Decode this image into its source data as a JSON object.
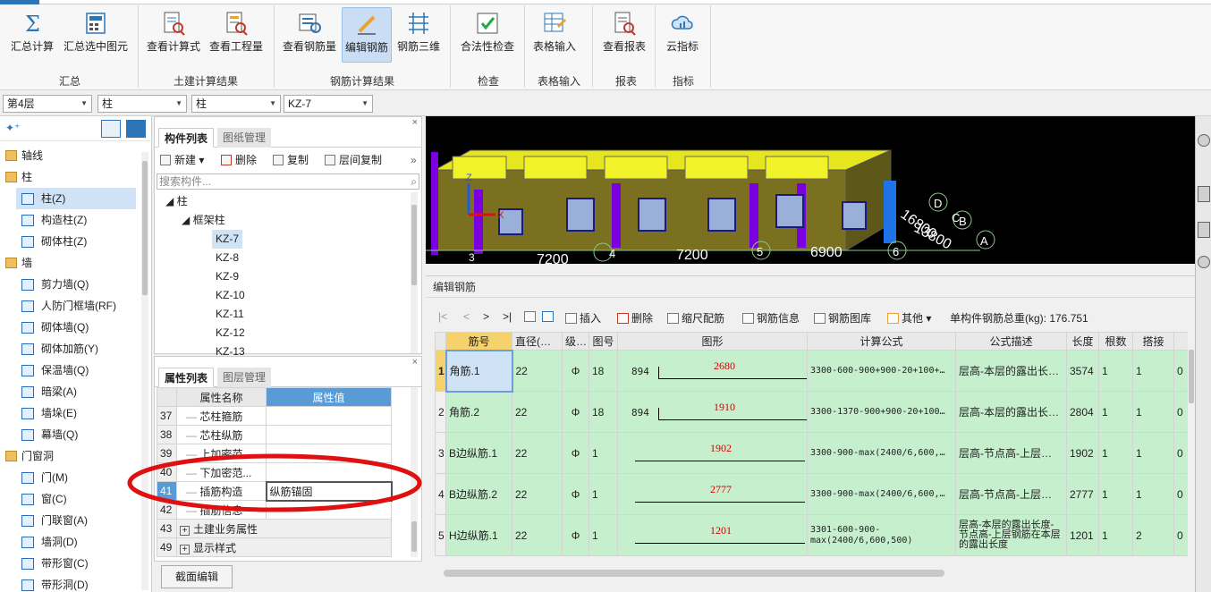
{
  "ribbon": {
    "buttons": [
      {
        "label": "汇总计算",
        "icon": "sigma-icon"
      },
      {
        "label": "汇总选中图元",
        "icon": "calculator-icon"
      },
      {
        "label": "查看计算式",
        "icon": "view-formula-icon"
      },
      {
        "label": "查看工程量",
        "icon": "view-quantity-icon"
      },
      {
        "label": "查看钢筋量",
        "icon": "view-rebar-icon"
      },
      {
        "label": "编辑钢筋",
        "icon": "edit-rebar-icon"
      },
      {
        "label": "钢筋三维",
        "icon": "rebar-3d-icon"
      },
      {
        "label": "合法性检查",
        "icon": "check-icon"
      },
      {
        "label": "表格输入",
        "icon": "table-input-icon"
      },
      {
        "label": "查看报表",
        "icon": "report-icon"
      },
      {
        "label": "云指标",
        "icon": "cloud-icon"
      }
    ],
    "groups": [
      "汇总",
      "土建计算结果",
      "钢筋计算结果",
      "检查",
      "表格输入",
      "报表",
      "指标"
    ]
  },
  "dropdowns": [
    "第4层",
    "柱",
    "柱",
    "KZ-7"
  ],
  "leftnav": {
    "items": [
      {
        "label": "轴线",
        "type": "group"
      },
      {
        "label": "柱",
        "type": "group"
      },
      {
        "label": "柱(Z)",
        "type": "item",
        "selected": true
      },
      {
        "label": "构造柱(Z)",
        "type": "item"
      },
      {
        "label": "砌体柱(Z)",
        "type": "item"
      },
      {
        "label": "墙",
        "type": "group"
      },
      {
        "label": "剪力墙(Q)",
        "type": "item"
      },
      {
        "label": "人防门框墙(RF)",
        "type": "item"
      },
      {
        "label": "砌体墙(Q)",
        "type": "item"
      },
      {
        "label": "砌体加筋(Y)",
        "type": "item"
      },
      {
        "label": "保温墙(Q)",
        "type": "item"
      },
      {
        "label": "暗梁(A)",
        "type": "item"
      },
      {
        "label": "墙垛(E)",
        "type": "item"
      },
      {
        "label": "幕墙(Q)",
        "type": "item"
      },
      {
        "label": "门窗洞",
        "type": "group"
      },
      {
        "label": "门(M)",
        "type": "item"
      },
      {
        "label": "窗(C)",
        "type": "item"
      },
      {
        "label": "门联窗(A)",
        "type": "item"
      },
      {
        "label": "墙洞(D)",
        "type": "item"
      },
      {
        "label": "带形窗(C)",
        "type": "item"
      },
      {
        "label": "带形洞(D)",
        "type": "item"
      }
    ]
  },
  "complist": {
    "tabs": [
      "构件列表",
      "图纸管理"
    ],
    "toolbar": [
      "新建",
      "删除",
      "复制",
      "层间复制"
    ],
    "search_placeholder": "搜索构件...",
    "tree_root": "柱",
    "tree_group": "框架柱",
    "tree_items": [
      "KZ-7",
      "KZ-8",
      "KZ-9",
      "KZ-10",
      "KZ-11",
      "KZ-12",
      "KZ-13"
    ]
  },
  "proppanel": {
    "tabs": [
      "属性列表",
      "图层管理"
    ],
    "col_name": "属性名称",
    "col_value": "属性值",
    "rows": [
      {
        "num": "37",
        "name": "芯柱箍筋",
        "value": ""
      },
      {
        "num": "38",
        "name": "芯柱纵筋",
        "value": ""
      },
      {
        "num": "39",
        "name": "上加密范...",
        "value": ""
      },
      {
        "num": "40",
        "name": "下加密范...",
        "value": ""
      },
      {
        "num": "41",
        "name": "插筋构造",
        "value": "纵筋锚固"
      },
      {
        "num": "42",
        "name": "插筋信息",
        "value": ""
      },
      {
        "num": "43",
        "name": "土建业务属性",
        "value": ""
      },
      {
        "num": "49",
        "name": "显示样式",
        "value": ""
      }
    ],
    "expand_symbol": "+"
  },
  "section_edit_label": "截面编辑",
  "view3d": {
    "axis_numbers": [
      "7200",
      "7200",
      "6900",
      "4",
      "5",
      "6",
      "A",
      "B",
      "C",
      "D",
      "13800",
      "16800",
      "3",
      "X",
      "Z"
    ]
  },
  "editor": {
    "title": "编辑钢筋",
    "nav": [
      "|<",
      "<",
      ">",
      ">|"
    ],
    "toolbar": [
      "插入",
      "删除",
      "缩尺配筋",
      "钢筋信息",
      "钢筋图库",
      "其他"
    ],
    "total_weight_label": "单构件钢筋总重(kg): 176.751",
    "columns": [
      "筋号",
      "直径(mm)",
      "级别",
      "图号",
      "图形",
      "计算公式",
      "公式描述",
      "长度",
      "根数",
      "搭接",
      ""
    ],
    "rows": [
      {
        "num": "1",
        "name": "角筋.1",
        "dia": "22",
        "grade": "Φ",
        "fig": "18",
        "shape_left": "894",
        "shape_val": "2680",
        "formula": "3300-600-900+900-20+100+…",
        "desc": "层高-本层的露出长…",
        "len": "3574",
        "count": "1",
        "lap": "1",
        "extra": "0"
      },
      {
        "num": "2",
        "name": "角筋.2",
        "dia": "22",
        "grade": "Φ",
        "fig": "18",
        "shape_left": "894",
        "shape_val": "1910",
        "formula": "3300-1370-900+900-20+100…",
        "desc": "层高-本层的露出长…",
        "len": "2804",
        "count": "1",
        "lap": "1",
        "extra": "0"
      },
      {
        "num": "3",
        "name": "B边纵筋.1",
        "dia": "22",
        "grade": "Φ",
        "fig": "1",
        "shape_left": "",
        "shape_val": "1902",
        "formula": "3300-900-max(2400/6,600,…",
        "desc": "层高-节点高-上层…",
        "len": "1902",
        "count": "1",
        "lap": "1",
        "extra": "0"
      },
      {
        "num": "4",
        "name": "B边纵筋.2",
        "dia": "22",
        "grade": "Φ",
        "fig": "1",
        "shape_left": "",
        "shape_val": "2777",
        "formula": "3300-900-max(2400/6,600,…",
        "desc": "层高-节点高-上层…",
        "len": "2777",
        "count": "1",
        "lap": "1",
        "extra": "0"
      },
      {
        "num": "5",
        "name": "H边纵筋.1",
        "dia": "22",
        "grade": "Φ",
        "fig": "1",
        "shape_left": "",
        "shape_val": "1201",
        "formula": "3301-600-900-max(2400/6,600,500)",
        "desc": "层高-本层的露出长度-节点高-上层钢筋在本层的露出长度",
        "len": "1201",
        "count": "1",
        "lap": "2",
        "extra": "0"
      }
    ]
  },
  "colors": {
    "accent": "#2e75b6",
    "rebar_row": "#c6efce",
    "highlight": "#f5d26b",
    "annotation": "#e01010"
  }
}
